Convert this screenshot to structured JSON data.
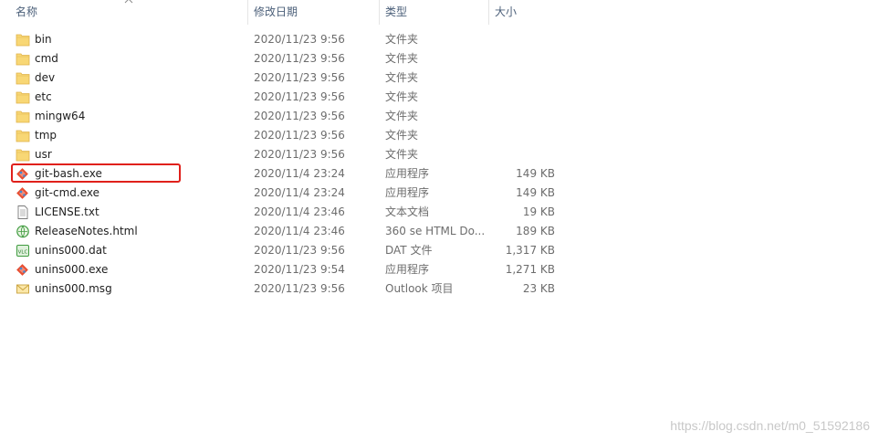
{
  "header": {
    "name": "名称",
    "date_modified": "修改日期",
    "type": "类型",
    "size": "大小"
  },
  "files": [
    {
      "icon": "folder-icon",
      "name": "bin",
      "date": "2020/11/23 9:56",
      "type": "文件夹",
      "size": ""
    },
    {
      "icon": "folder-icon",
      "name": "cmd",
      "date": "2020/11/23 9:56",
      "type": "文件夹",
      "size": ""
    },
    {
      "icon": "folder-icon",
      "name": "dev",
      "date": "2020/11/23 9:56",
      "type": "文件夹",
      "size": ""
    },
    {
      "icon": "folder-icon",
      "name": "etc",
      "date": "2020/11/23 9:56",
      "type": "文件夹",
      "size": ""
    },
    {
      "icon": "folder-icon",
      "name": "mingw64",
      "date": "2020/11/23 9:56",
      "type": "文件夹",
      "size": ""
    },
    {
      "icon": "folder-icon",
      "name": "tmp",
      "date": "2020/11/23 9:56",
      "type": "文件夹",
      "size": ""
    },
    {
      "icon": "folder-icon",
      "name": "usr",
      "date": "2020/11/23 9:56",
      "type": "文件夹",
      "size": ""
    },
    {
      "icon": "git-icon",
      "name": "git-bash.exe",
      "date": "2020/11/4 23:24",
      "type": "应用程序",
      "size": "149 KB"
    },
    {
      "icon": "git-icon",
      "name": "git-cmd.exe",
      "date": "2020/11/4 23:24",
      "type": "应用程序",
      "size": "149 KB"
    },
    {
      "icon": "text-file-icon",
      "name": "LICENSE.txt",
      "date": "2020/11/4 23:46",
      "type": "文本文档",
      "size": "19 KB"
    },
    {
      "icon": "html-file-icon",
      "name": "ReleaseNotes.html",
      "date": "2020/11/4 23:46",
      "type": "360 se HTML Do...",
      "size": "189 KB"
    },
    {
      "icon": "dat-file-icon",
      "name": "unins000.dat",
      "date": "2020/11/23 9:56",
      "type": "DAT 文件",
      "size": "1,317 KB"
    },
    {
      "icon": "git-icon",
      "name": "unins000.exe",
      "date": "2020/11/23 9:54",
      "type": "应用程序",
      "size": "1,271 KB"
    },
    {
      "icon": "mail-file-icon",
      "name": "unins000.msg",
      "date": "2020/11/23 9:56",
      "type": "Outlook 项目",
      "size": "23 KB"
    }
  ],
  "watermark": "https://blog.csdn.net/m0_51592186",
  "colors": {
    "folder": "#f8d775",
    "highlight": "#e0201b",
    "header_text": "#4c607a",
    "git_red": "#e84e31",
    "git_blue": "#3c8dd8"
  }
}
